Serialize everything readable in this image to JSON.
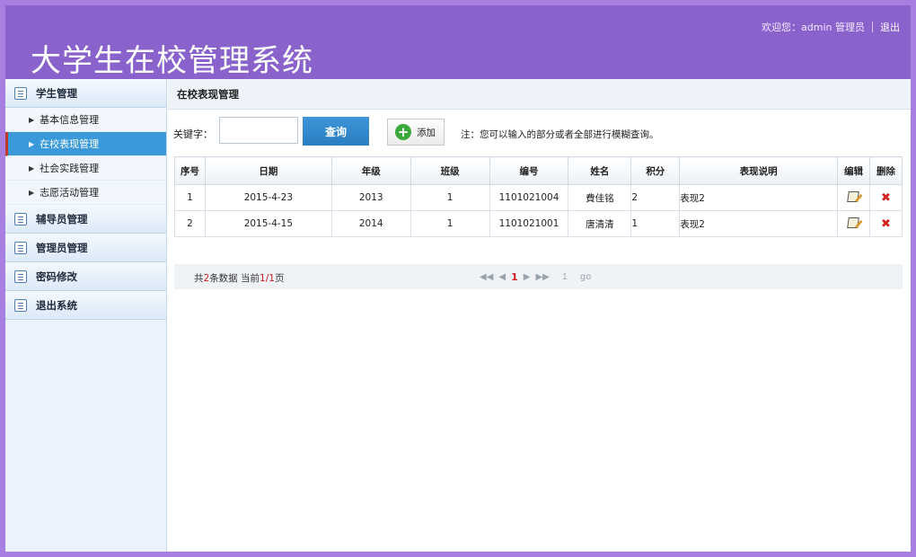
{
  "header": {
    "app_title": "大学生在校管理系统",
    "welcome": "欢迎您：admin 管理员",
    "logout": "退出"
  },
  "sidebar": {
    "groups": [
      {
        "label": "学生管理"
      },
      {
        "label": "辅导员管理"
      },
      {
        "label": "管理员管理"
      },
      {
        "label": "密码修改"
      },
      {
        "label": "退出系统"
      }
    ],
    "sub_items": [
      {
        "label": "基本信息管理"
      },
      {
        "label": "在校表现管理"
      },
      {
        "label": "社会实践管理"
      },
      {
        "label": "志愿活动管理"
      }
    ]
  },
  "main": {
    "title": "在校表现管理",
    "search": {
      "label": "关键字：",
      "value": "",
      "query_button": "查询",
      "add_button": "添加",
      "hint": "注：您可以输入的部分或者全部进行模糊查询。"
    },
    "table": {
      "headers": [
        "序号",
        "日期",
        "年级",
        "班级",
        "编号",
        "姓名",
        "积分",
        "表现说明",
        "编辑",
        "删除"
      ],
      "rows": [
        [
          "1",
          "2015-4-23",
          "2013",
          "1",
          "1101021004",
          "費佳铭",
          "2",
          "表现2"
        ],
        [
          "2",
          "2015-4-15",
          "2014",
          "1",
          "1101021001",
          "唐清清",
          "1",
          "表现2"
        ]
      ]
    },
    "pager": {
      "prefix": "共",
      "count": "2",
      "middle": "条数据 当前",
      "current": "1",
      "slash": "/",
      "total": "1",
      "suffix": "页",
      "nav_first": "◀◀",
      "nav_prev": "◀",
      "nav_page": "1",
      "nav_next": "▶",
      "nav_last": "▶▶",
      "page_input": "1",
      "go": "go"
    }
  },
  "colors": {
    "header_bg": "#8a62cc",
    "active_menu": "#3a9ad9",
    "query_button": "#2a7ec1"
  }
}
